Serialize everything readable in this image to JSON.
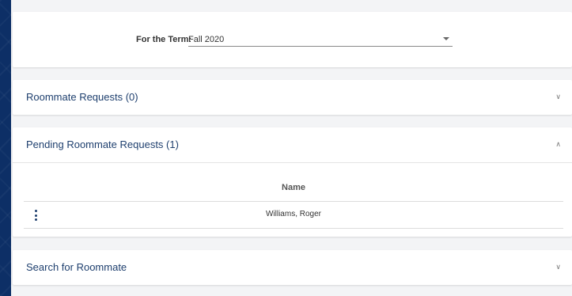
{
  "term": {
    "label": "For the Term:",
    "value": "Fall 2020"
  },
  "panels": {
    "roommate_requests": {
      "title": "Roommate Requests (0)",
      "state_icon": "chevron-down-icon"
    },
    "pending_requests": {
      "title": "Pending Roommate Requests (1)",
      "state_icon": "chevron-up-icon"
    },
    "search": {
      "title": "Search for Roommate",
      "state_icon": "chevron-down-icon"
    }
  },
  "pending_table": {
    "columns": [
      "Name"
    ],
    "rows": [
      {
        "name": "Williams, Roger",
        "actions_icon": "more-vert-icon"
      }
    ]
  },
  "colors": {
    "background": "#0d2f66",
    "panel_title": "#1e3f6e"
  }
}
